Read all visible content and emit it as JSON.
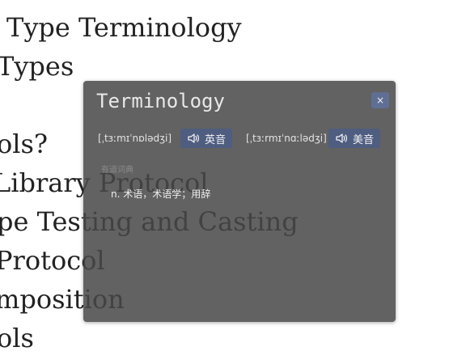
{
  "background": {
    "lines": [
      "Type Terminology",
      "Types",
      "",
      "ols?",
      "Library Protocol",
      "pe Testing and Casting",
      "Protocol",
      "mposition",
      "ols"
    ]
  },
  "popup": {
    "title": "Terminology",
    "close_label": "×",
    "uk": {
      "phonetic": "[ˌtɜːmɪˈnɒlədʒi]",
      "label": "英音"
    },
    "us": {
      "phonetic": "[ˌtɜːrmɪˈnɑːlədʒi]",
      "label": "美音"
    },
    "source": "有道词典",
    "definition": "n. 术语，术语学；用辞"
  }
}
